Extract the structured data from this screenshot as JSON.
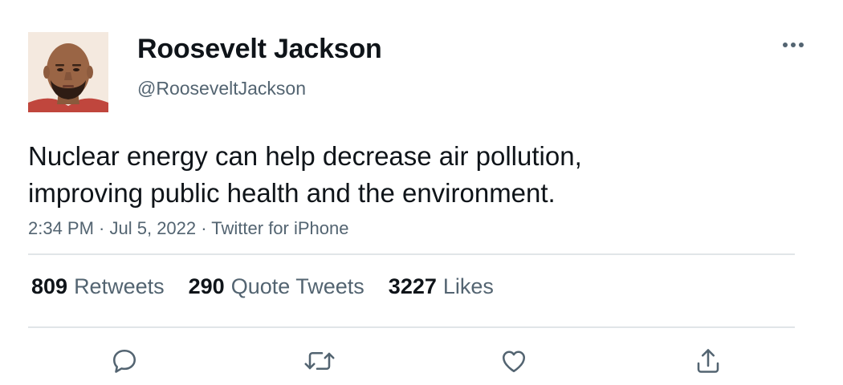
{
  "user": {
    "display_name": "Roosevelt Jackson",
    "handle": "@RooseveltJackson",
    "avatar": "avatar-photo"
  },
  "tweet": {
    "text_lines": [
      "Nuclear energy can help decrease air pollution,",
      "improving public health and the environment."
    ],
    "time": "2:34 PM",
    "date": "Jul 5, 2022",
    "source": "Twitter for iPhone",
    "separator": " · "
  },
  "stats": {
    "retweets": {
      "count": "809",
      "label": "Retweets"
    },
    "quote_tweets": {
      "count": "290",
      "label": "Quote Tweets"
    },
    "likes": {
      "count": "3227",
      "label": "Likes"
    }
  },
  "actions": {
    "reply": "reply-icon",
    "retweet": "retweet-icon",
    "like": "heart-icon",
    "share": "share-icon",
    "more": "more-icon"
  },
  "colors": {
    "text_primary": "#0f1419",
    "text_secondary": "#536471",
    "divider": "#e1e5e8",
    "icon": "#536471"
  }
}
